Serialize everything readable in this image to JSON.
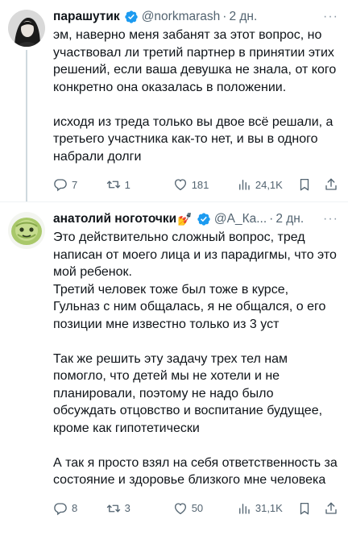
{
  "tweets": [
    {
      "author_name": "парашутик",
      "handle": "@norkmarash",
      "separator": "·",
      "time": "2 дн.",
      "more": "···",
      "paragraphs": [
        "эм, наверно меня забанят за этот вопрос, но участвовал ли третий партнер в принятии этих решений, если ваша девушка не знала, от кого конкретно она оказалась в положении.",
        "исходя из треда только вы двое всё решали, а третьего участника как-то нет, и вы в одного набрали долги"
      ],
      "stats": {
        "replies": "7",
        "retweets": "1",
        "likes": "181",
        "views": "24,1K"
      },
      "icons": [
        "verified-badge-icon",
        "reply-icon",
        "retweet-icon",
        "like-icon",
        "views-icon",
        "bookmark-icon",
        "share-icon"
      ]
    },
    {
      "author_name": "анатолий ноготочки",
      "name_emoji": "💅",
      "handle": "@А_Ка...",
      "separator": "·",
      "time": "2 дн.",
      "more": "···",
      "paragraphs": [
        "Это действительно сложный вопрос, тред написан от моего лица и из парадигмы, что это мой ребенок.",
        "Третий человек тоже был тоже в курсе, Гульназ с ним общалась, я не общался, о его позиции мне известно только из 3 уст",
        "Так же решить эту задачу трех тел нам помогло, что детей мы не хотели и не планировали, поэтому не надо было обсуждать отцовство и воспитание будущее, кроме как гипотетически",
        "А так я просто взял на себя ответственность за состояние и здоровье близкого мне человека"
      ],
      "stats": {
        "replies": "8",
        "retweets": "3",
        "likes": "50",
        "views": "31,1K"
      },
      "icons": [
        "verified-badge-icon",
        "reply-icon",
        "retweet-icon",
        "like-icon",
        "views-icon",
        "bookmark-icon",
        "share-icon"
      ]
    }
  ],
  "colors": {
    "verified": "#1d9bf0",
    "secondary_text": "#536471",
    "text": "#0f1419",
    "thread_line": "#cfd9de"
  }
}
